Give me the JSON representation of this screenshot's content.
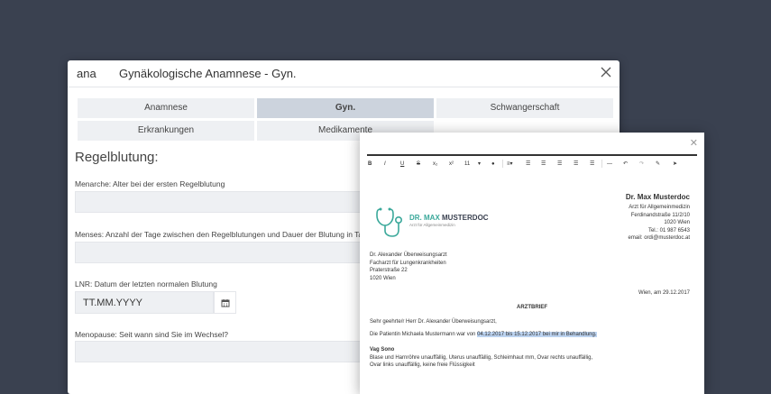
{
  "window": {
    "code": "ana",
    "title": "Gynäkologische Anamnese - Gyn."
  },
  "tabs": [
    {
      "label": "Anamnese",
      "active": false
    },
    {
      "label": "Gyn.",
      "active": true
    },
    {
      "label": "Schwangerschaft",
      "active": false
    },
    {
      "label": "Erkrankungen",
      "active": false
    },
    {
      "label": "Medikamente",
      "active": false
    }
  ],
  "form": {
    "section_title": "Regelblutung:",
    "menarche_label": "Menarche: Alter bei der ersten Regelblutung",
    "menses_label": "Menses: Anzahl der Tage zwischen den Regelblutungen und Dauer der Blutung in Tagen",
    "lnr_label": "LNR: Datum der letzten normalen Blutung",
    "lnr_value": "TT.MM.YYYY",
    "menopause_label": "Menopause: Seit wann sind Sie im Wechsel?"
  },
  "toolbar": {
    "items": [
      "B",
      "I",
      "U",
      "S",
      "x₂",
      "x²",
      "11",
      "▾",
      "●",
      "≡▾",
      "☰",
      "☰",
      "☰",
      "☰",
      "☰",
      "☰",
      "—",
      "↶",
      "↷",
      "✎",
      "➤"
    ]
  },
  "letter": {
    "logo_name_1": "DR. MAX",
    "logo_name_2": "MUSTERDOC",
    "logo_sub": "Arzt für Allgemeinmedizin",
    "sender_name": "Dr. Max Musterdoc",
    "sender_lines": [
      "Arzt für Allgemeinmedizin",
      "Ferdinandstraße 11/2/10",
      "1020 Wien",
      "Tel.: 01 987 6543",
      "email: ordi@musterdoc.at"
    ],
    "recipient_lines": [
      "Dr. Alexander Überweisungsarzt",
      "Facharzt für Lungenkrankheiten",
      "Praterstraße 22",
      "1020 Wien"
    ],
    "date": "Wien, am 29.12.2017",
    "subject": "ARZTBRIEF",
    "salutation": "Sehr geehrte/r Herr Dr. Alexander Überweisungsarzt,",
    "body_prefix": "Die Patientin Michaela Mustermann war von",
    "body_highlight": "04.12.2017 bis 15.12.2017 bei mir in Behandlung.",
    "section": "Vag Sono",
    "finding_1": "Blase und Harnröhre unauffällig, Uterus unauffällig, Schleimhaut mm, Ovar rechts unauffällig,",
    "finding_2": "Ovar links unauffällig, keine freie Flüssigkeit"
  },
  "colors": {
    "background": "#3a4150",
    "accent": "#3aa89a",
    "highlight": "#bcd3f0",
    "tab_active": "#ccd3dd"
  }
}
